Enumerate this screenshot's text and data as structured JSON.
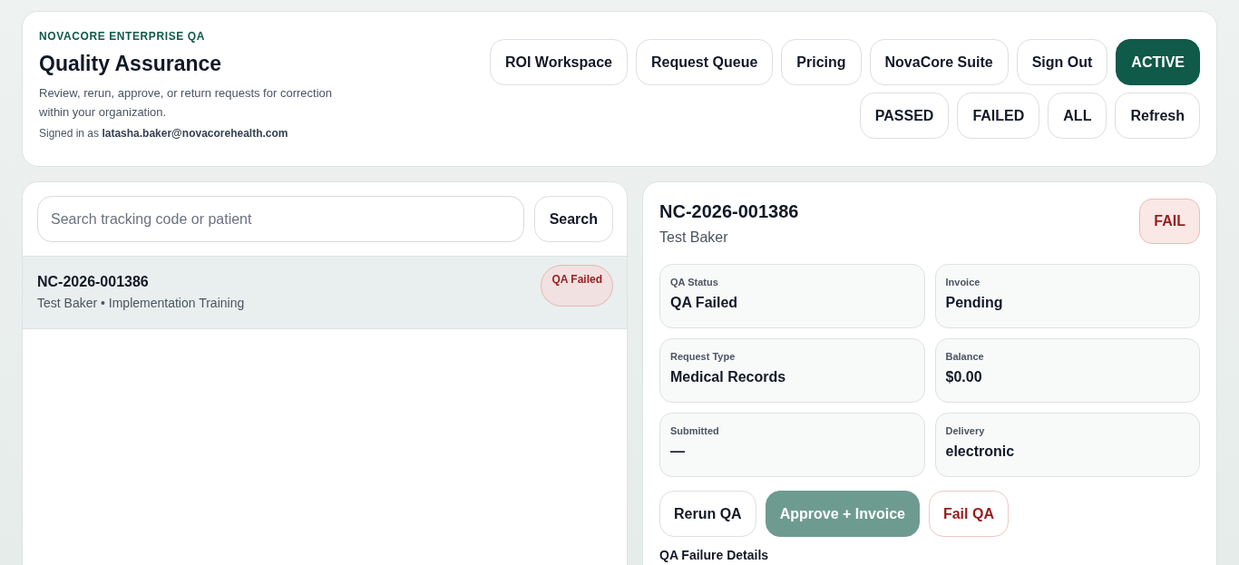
{
  "header": {
    "eyebrow": "NOVACORE ENTERPRISE QA",
    "title": "Quality Assurance",
    "description": "Review, rerun, approve, or return requests for correction within your organization.",
    "signed_in": "Signed in as **latasha.baker@novacorehealth.com**",
    "button_rows": [
      [
        {
          "label": "ROI Workspace",
          "selected": false
        },
        {
          "label": "Request Queue",
          "selected": false
        },
        {
          "label": "Pricing",
          "selected": false
        },
        {
          "label": "NovaCore Suite",
          "selected": false
        },
        {
          "label": "Sign Out",
          "selected": false
        },
        {
          "label": "ACTIVE",
          "selected": true
        }
      ],
      [
        {
          "label": "PASSED",
          "selected": false
        },
        {
          "label": "FAILED",
          "selected": false
        },
        {
          "label": "ALL",
          "selected": false
        },
        {
          "label": "Refresh",
          "selected": false
        }
      ]
    ]
  },
  "search": {
    "placeholder": "Search tracking code or patient",
    "button": "Search"
  },
  "requests": [
    {
      "code": "NC-2026-001386",
      "subtitle": "Test Baker • Implementation Training",
      "badge": "QA Failed",
      "selected": true
    }
  ],
  "detail": {
    "code": "NC-2026-001386",
    "patient": "Test Baker",
    "badge": "FAIL",
    "fields": [
      {
        "label": "QA Status",
        "value": "QA Failed"
      },
      {
        "label": "Invoice",
        "value": "Pending"
      },
      {
        "label": "Request Type",
        "value": "Medical Records"
      },
      {
        "label": "Balance",
        "value": "$0.00"
      },
      {
        "label": "Submitted",
        "value": "—"
      },
      {
        "label": "Delivery",
        "value": "electronic"
      }
    ],
    "actions": [
      {
        "label": "Rerun QA",
        "kind": "neutral",
        "disabled": false
      },
      {
        "label": "Approve + Invoice",
        "kind": "primary",
        "disabled": true
      },
      {
        "label": "Fail QA",
        "kind": "danger",
        "disabled": false
      }
    ],
    "section_title": "QA Failure Details"
  }
}
